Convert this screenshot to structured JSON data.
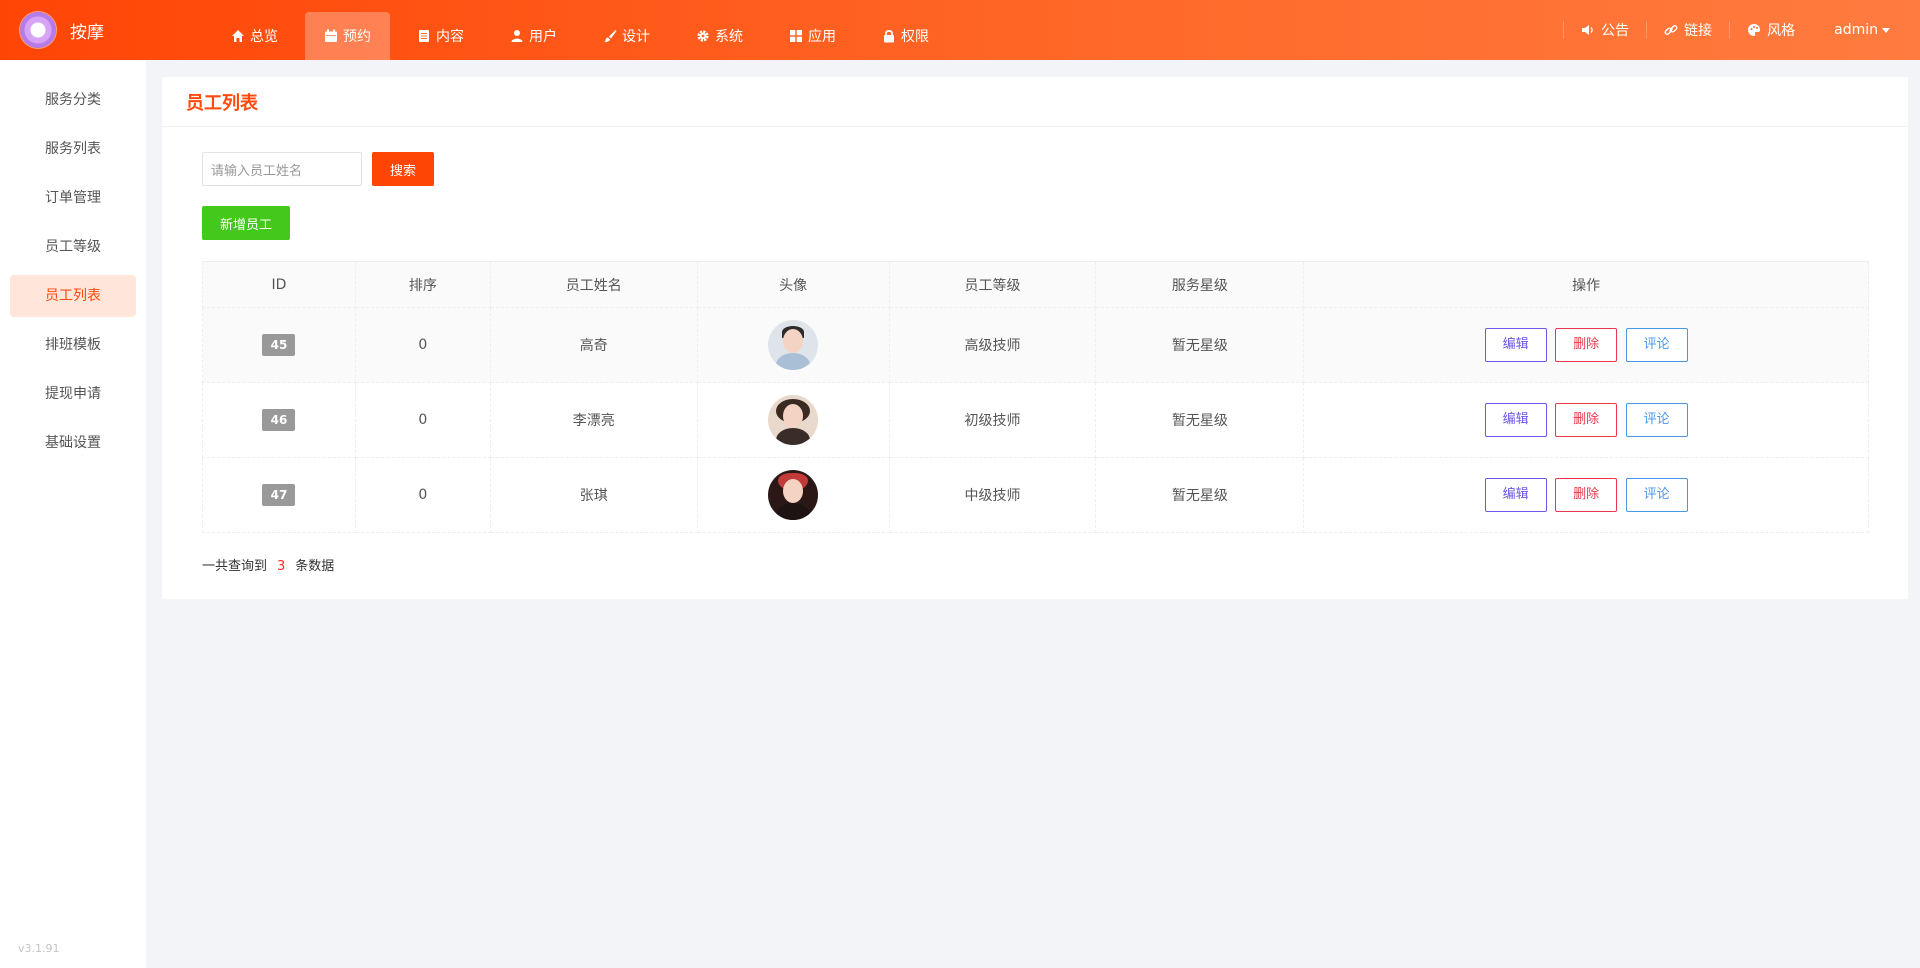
{
  "header": {
    "brand": "按摩",
    "nav": [
      {
        "label": "总览",
        "icon": "home-icon"
      },
      {
        "label": "预约",
        "icon": "calendar-icon",
        "active": true
      },
      {
        "label": "内容",
        "icon": "document-icon"
      },
      {
        "label": "用户",
        "icon": "user-icon"
      },
      {
        "label": "设计",
        "icon": "brush-icon"
      },
      {
        "label": "系统",
        "icon": "gear-icon"
      },
      {
        "label": "应用",
        "icon": "grid-icon"
      },
      {
        "label": "权限",
        "icon": "lock-icon"
      }
    ],
    "tools": [
      {
        "label": "公告",
        "icon": "speaker-icon"
      },
      {
        "label": "链接",
        "icon": "link-icon"
      },
      {
        "label": "风格",
        "icon": "palette-icon"
      }
    ],
    "user": "admin"
  },
  "sidebar": {
    "items": [
      "服务分类",
      "服务列表",
      "订单管理",
      "员工等级",
      "员工列表",
      "排班模板",
      "提现申请",
      "基础设置"
    ],
    "active_index": 4,
    "version": "v3.1.91"
  },
  "main": {
    "title": "员工列表",
    "search_placeholder": "请输入员工姓名",
    "search_button": "搜索",
    "add_button": "新增员工",
    "columns": [
      "ID",
      "排序",
      "员工姓名",
      "头像",
      "员工等级",
      "服务星级",
      "操作"
    ],
    "rows": [
      {
        "id": "45",
        "sort": "0",
        "name": "高奇",
        "level": "高级技师",
        "stars": "暂无星级"
      },
      {
        "id": "46",
        "sort": "0",
        "name": "李漂亮",
        "level": "初级技师",
        "stars": "暂无星级"
      },
      {
        "id": "47",
        "sort": "0",
        "name": "张琪",
        "level": "中级技师",
        "stars": "暂无星级"
      }
    ],
    "actions": {
      "edit": "编辑",
      "delete": "删除",
      "comment": "评论"
    },
    "summary": {
      "prefix": "一共查询到",
      "count": "3",
      "suffix": "条数据"
    }
  },
  "colors": {
    "accent": "#ff4506",
    "add": "#43c81b",
    "edit": "#6b58e8",
    "delete": "#e8394b",
    "comment": "#4a97e8"
  }
}
